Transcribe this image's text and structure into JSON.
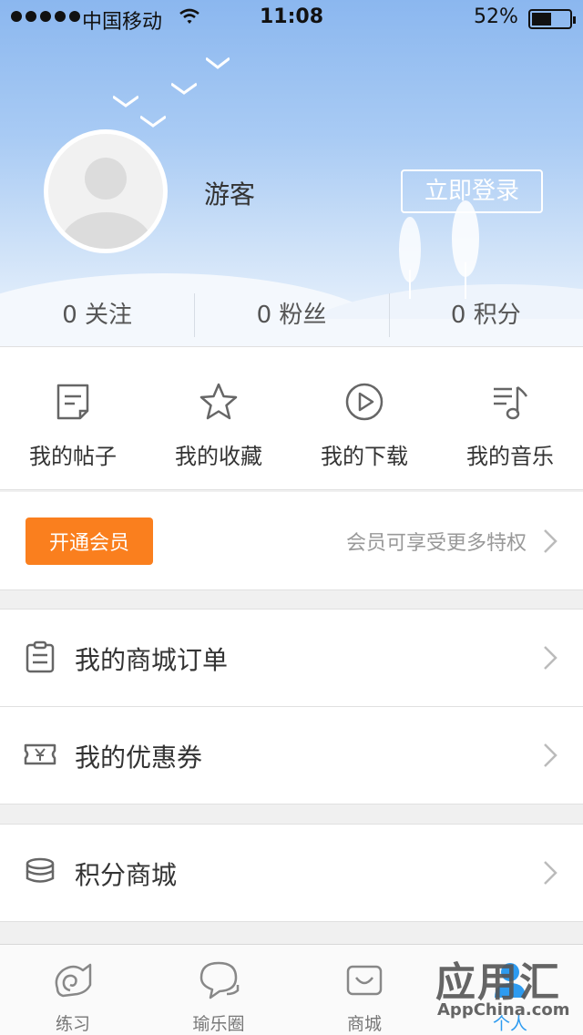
{
  "status_bar": {
    "carrier": "中国移动",
    "time": "11:08",
    "battery_percent": "52%",
    "battery_level": 0.52
  },
  "profile": {
    "username": "游客",
    "login_label": "立即登录"
  },
  "stats": [
    {
      "label": "0 关注"
    },
    {
      "label": "0 粉丝"
    },
    {
      "label": "0 积分"
    }
  ],
  "quick_actions": [
    {
      "label": "我的帖子",
      "icon": "post-icon"
    },
    {
      "label": "我的收藏",
      "icon": "star-icon"
    },
    {
      "label": "我的下载",
      "icon": "download-play-icon"
    },
    {
      "label": "我的音乐",
      "icon": "music-icon"
    }
  ],
  "membership": {
    "button_label": "开通会员",
    "description": "会员可享受更多特权"
  },
  "menu": [
    {
      "label": "我的商城订单",
      "icon": "clipboard-icon"
    },
    {
      "label": "我的优惠券",
      "icon": "coupon-icon"
    },
    {
      "label": "积分商城",
      "icon": "coins-icon"
    }
  ],
  "tabbar": {
    "tabs": [
      {
        "label": "练习",
        "icon": "practice-icon",
        "active": false
      },
      {
        "label": "瑜乐圈",
        "icon": "chat-icon",
        "active": false
      },
      {
        "label": "商城",
        "icon": "shop-icon",
        "active": false
      },
      {
        "label": "个人",
        "icon": "person-icon",
        "active": true
      }
    ]
  },
  "watermark": {
    "title": "应用汇",
    "subtitle": "AppChina.com"
  },
  "colors": {
    "accent_orange": "#fa7f1e",
    "active_blue": "#2d9bf0",
    "header_blue": "#8bb7ef"
  }
}
